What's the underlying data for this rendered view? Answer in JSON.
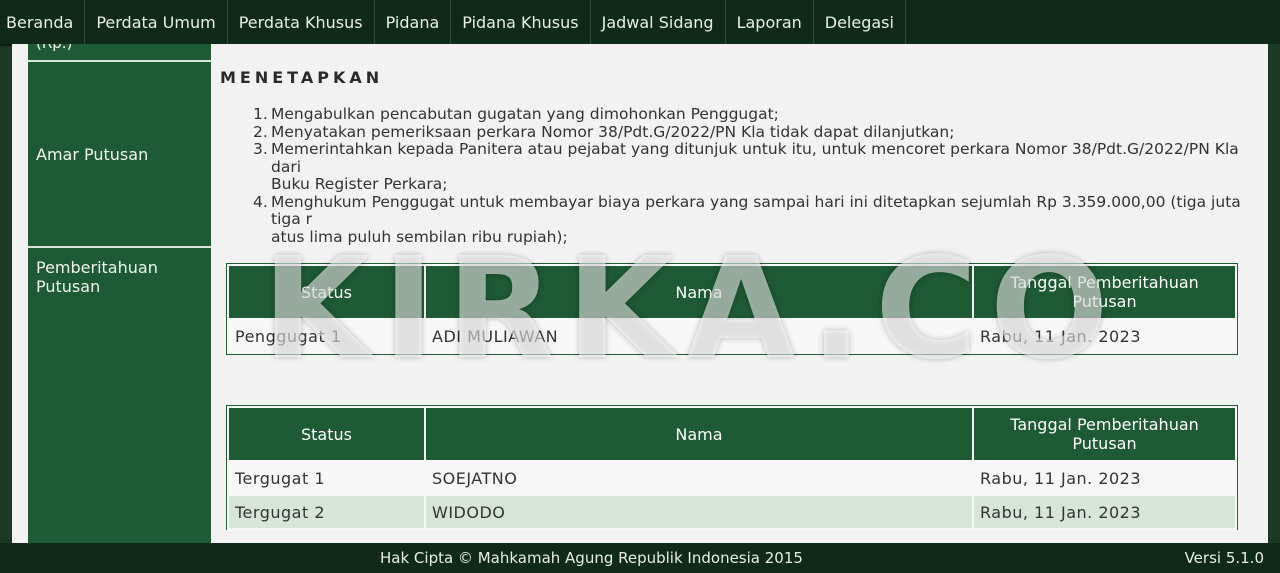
{
  "nav": [
    "Beranda",
    "Perdata Umum",
    "Perdata Khusus",
    "Pidana",
    "Pidana Khusus",
    "Jadwal Sidang",
    "Laporan",
    "Delegasi"
  ],
  "sidebar": {
    "top_partial": "(Rp.)",
    "amar_label": "Amar Putusan",
    "pemberitahuan_label_1": "Pemberitahuan",
    "pemberitahuan_label_2": "Putusan"
  },
  "amar": {
    "heading": "MENETAPKAN",
    "items": [
      {
        "num": "1.",
        "lines": [
          "Mengabulkan pencabutan gugatan yang dimohonkan Penggugat;"
        ]
      },
      {
        "num": "2.",
        "lines": [
          "Menyatakan pemeriksaan perkara Nomor 38/Pdt.G/2022/PN Kla tidak dapat dilanjutkan;"
        ]
      },
      {
        "num": "3.",
        "lines": [
          "Memerintahkan kepada Panitera atau pejabat yang ditunjuk untuk itu, untuk mencoret perkara Nomor 38/Pdt.G/2022/PN Kla dari",
          "Buku Register Perkara;"
        ]
      },
      {
        "num": "4.",
        "lines": [
          "Menghukum Penggugat untuk membayar biaya perkara yang sampai hari ini ditetapkan sejumlah Rp 3.359.000,00 (tiga juta tiga r",
          "atus lima puluh sembilan ribu rupiah);"
        ]
      }
    ]
  },
  "table_headers": {
    "status": "Status",
    "nama": "Nama",
    "tanggal_1": "Tanggal Pemberitahuan",
    "tanggal_2": "Putusan"
  },
  "penggugat_rows": [
    {
      "status": "Penggugat 1",
      "nama": "ADI MULIAWAN",
      "tanggal": "Rabu, 11 Jan. 2023"
    }
  ],
  "tergugat_rows": [
    {
      "status": "Tergugat 1",
      "nama": "SOEJATNO",
      "tanggal": "Rabu, 11 Jan. 2023"
    },
    {
      "status": "Tergugat 2",
      "nama": "WIDODO",
      "tanggal": "Rabu, 11 Jan. 2023"
    }
  ],
  "watermark": "KIRKA.CO",
  "footer": {
    "copyright": "Hak Cipta © Mahkamah Agung Republik Indonesia 2015",
    "version": "Versi 5.1.0"
  }
}
